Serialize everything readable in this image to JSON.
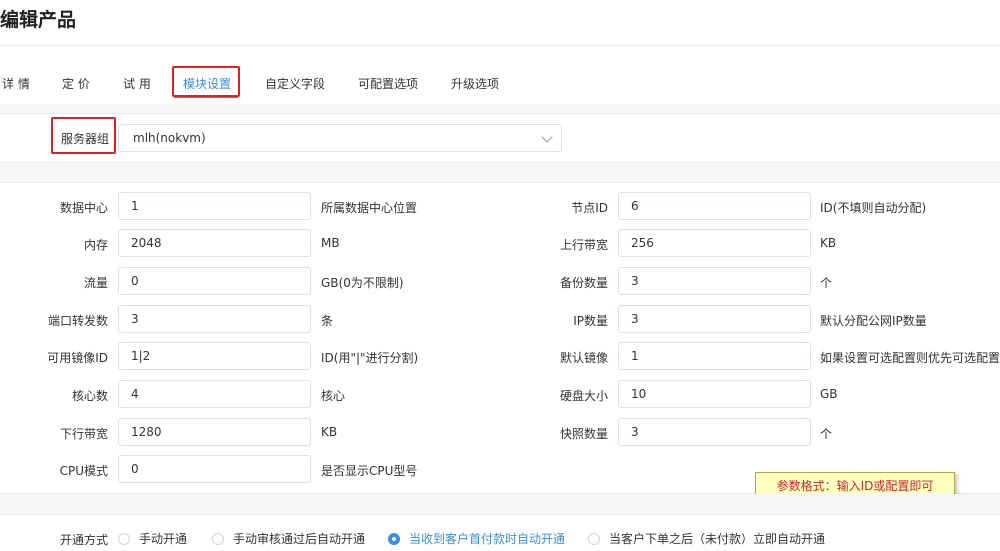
{
  "page": {
    "title": "编辑产品"
  },
  "tabs": [
    {
      "label": "详 情"
    },
    {
      "label": "定 价"
    },
    {
      "label": "试 用"
    },
    {
      "label": "模块设置"
    },
    {
      "label": "自定义字段"
    },
    {
      "label": "可配置选项"
    },
    {
      "label": "升级选项"
    }
  ],
  "active_tab": "模块设置",
  "server_group": {
    "label": "服务器组",
    "value": "mlh(nokvm)"
  },
  "fields_left": [
    {
      "label": "数据中心",
      "value": "1",
      "hint": "所属数据中心位置"
    },
    {
      "label": "内存",
      "value": "2048",
      "hint": "MB"
    },
    {
      "label": "流量",
      "value": "0",
      "hint": "GB(0为不限制)"
    },
    {
      "label": "端口转发数",
      "value": "3",
      "hint": "条"
    },
    {
      "label": "可用镜像ID",
      "value": "1|2",
      "hint": "ID(用\"|\"进行分割)"
    },
    {
      "label": "核心数",
      "value": "4",
      "hint": "核心"
    },
    {
      "label": "下行带宽",
      "value": "1280",
      "hint": "KB"
    },
    {
      "label": "CPU模式",
      "value": "0",
      "hint": "是否显示CPU型号"
    }
  ],
  "fields_right": [
    {
      "label": "节点ID",
      "value": "6",
      "hint": "ID(不填则自动分配)"
    },
    {
      "label": "上行带宽",
      "value": "256",
      "hint": "KB"
    },
    {
      "label": "备份数量",
      "value": "3",
      "hint": "个"
    },
    {
      "label": "IP数量",
      "value": "3",
      "hint": "默认分配公网IP数量"
    },
    {
      "label": "默认镜像",
      "value": "1",
      "hint": "如果设置可选配置则优先可选配置"
    },
    {
      "label": "硬盘大小",
      "value": "10",
      "hint": "GB"
    },
    {
      "label": "快照数量",
      "value": "3",
      "hint": "个"
    }
  ],
  "tooltip": "参数格式：输入ID或配置即可",
  "provision": {
    "label": "开通方式",
    "options": [
      {
        "label": "手动开通",
        "checked": false
      },
      {
        "label": "手动审核通过后自动开通",
        "checked": false
      },
      {
        "label": "当收到客户首付款时自动开通",
        "checked": true
      },
      {
        "label": "当客户下单之后（未付款）立即自动开通",
        "checked": false
      }
    ]
  },
  "colors": {
    "accent": "#3a8ee6",
    "highlight_border": "#e02020",
    "tooltip_bg": "#ffffc0",
    "tooltip_text": "#d0282c"
  }
}
